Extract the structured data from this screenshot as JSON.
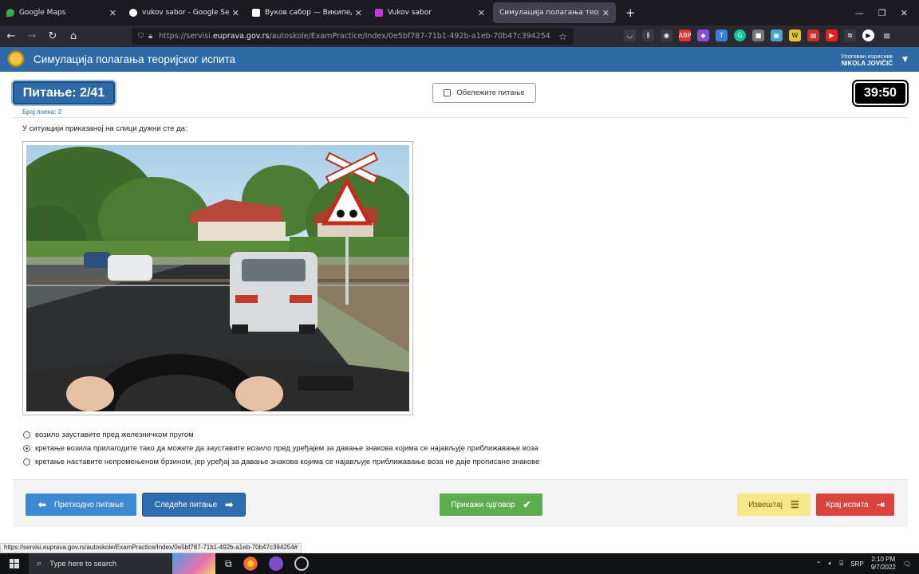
{
  "browser": {
    "tabs": [
      {
        "title": "Google Maps",
        "icon": "map-pin-icon",
        "color": "#34a853",
        "active": false
      },
      {
        "title": "vukov sabor - Google Search",
        "icon": "google-icon",
        "color": "#ffffff",
        "active": false
      },
      {
        "title": "Вуков сабор — Википедија",
        "icon": "wikipedia-icon",
        "color": "#ffffff",
        "active": false
      },
      {
        "title": "Vukov sabor",
        "icon": "app-icon",
        "color": "#c43bd1",
        "active": false
      },
      {
        "title": "Симулација полагања теоријског",
        "icon": "page-icon",
        "color": "#42414d",
        "active": true
      }
    ],
    "url_prefix": "https://servisi.",
    "url_domain": "euprava.gov.rs",
    "url_path": "/autoskole/ExamPractice/Index/0e5bf787-71b1-492b-a1eb-70b47c394254",
    "status_url": "https://servisi.euprava.gov.rs/autoskole/ExamPractice/Index/0e5bf787-71b1-492b-a1eb-70b47c394254#"
  },
  "app": {
    "title": "Симулација полагања теоријског испита",
    "user_label": "Улогован корисник",
    "user_name": "NIKOLA JOVIČIĆ"
  },
  "question": {
    "number_label": "Питање: 2/41",
    "points_label": "Број поена: 2",
    "mark_label": "Обележите питање",
    "timer": "39:50",
    "text": "У ситуацији приказаној на слици дужни сте да:",
    "answers": [
      {
        "text": "возило зауставите пред железничком пругом",
        "selected": false
      },
      {
        "text": "кретање возила прилагодите тако да можете да зауставите возило пред уређајем за давање знакова којима се најављује приближавање воза",
        "selected": true
      },
      {
        "text": "кретање наставите непромењеном брзином, јер уређај за давање знакова којима се најављује приближавање воза не даје прописане знакове",
        "selected": false
      }
    ]
  },
  "footer": {
    "prev_label": "Претходно питање",
    "next_label": "Следеће питање",
    "show_answer_label": "Прикажи одговор",
    "report_label": "Извештај",
    "end_label": "Крај испита"
  },
  "taskbar": {
    "search_placeholder": "Type here to search",
    "lang": "SRP",
    "time": "2:10 PM",
    "date": "9/7/2022"
  }
}
